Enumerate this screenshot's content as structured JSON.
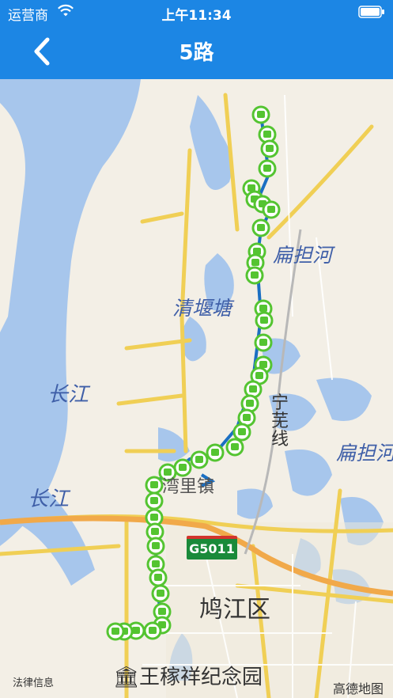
{
  "status_bar": {
    "carrier": "运营商",
    "time": "上午11:34"
  },
  "nav": {
    "title": "5路",
    "back_icon": "chevron-left-icon"
  },
  "map": {
    "labels": {
      "river_1": "长江",
      "river_2": "长江",
      "qingyan": "清堰塘",
      "biandan_1": "扁担河",
      "biandan_2": "扁担河",
      "town": "湾里镇",
      "highway": "宁芜线",
      "district": "鸠江区",
      "park": "王稼祥纪念园",
      "highway_shield": "G5011"
    },
    "legal": "法律信息",
    "provider": "高德地图",
    "route_color": "#1b6fc2",
    "stop_color": "#54c431"
  }
}
